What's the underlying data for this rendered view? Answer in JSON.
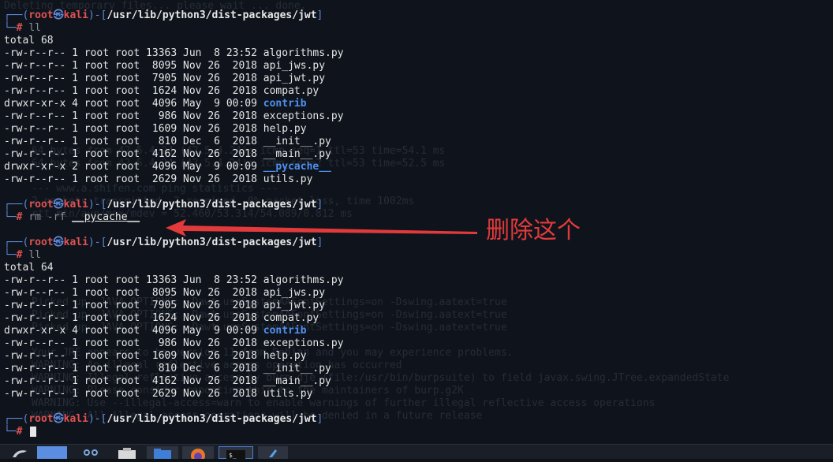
{
  "annotation": {
    "text": "删除这个"
  },
  "prompts": [
    {
      "user": "root",
      "host": "kali",
      "path": "/usr/lib/python3/dist-packages/jwt",
      "command": "ll"
    },
    {
      "user": "root",
      "host": "kali",
      "path": "/usr/lib/python3/dist-packages/jwt",
      "command_prefix": "rm -rf",
      "command_arg": "__pycache__"
    },
    {
      "user": "root",
      "host": "kali",
      "path": "/usr/lib/python3/dist-packages/jwt",
      "command": "ll"
    },
    {
      "user": "root",
      "host": "kali",
      "path": "/usr/lib/python3/dist-packages/jwt",
      "command": ""
    }
  ],
  "listing_before": {
    "total": "total 68",
    "rows": [
      {
        "perm": "-rw-r--r--",
        "links": "1",
        "owner": "root",
        "group": "root",
        "size": "13363",
        "month": "Jun",
        "day": " 8",
        "time": "23:52",
        "name": "algorithms.py",
        "is_dir": false
      },
      {
        "perm": "-rw-r--r--",
        "links": "1",
        "owner": "root",
        "group": "root",
        "size": " 8095",
        "month": "Nov",
        "day": "26",
        "time": " 2018",
        "name": "api_jws.py",
        "is_dir": false
      },
      {
        "perm": "-rw-r--r--",
        "links": "1",
        "owner": "root",
        "group": "root",
        "size": " 7905",
        "month": "Nov",
        "day": "26",
        "time": " 2018",
        "name": "api_jwt.py",
        "is_dir": false
      },
      {
        "perm": "-rw-r--r--",
        "links": "1",
        "owner": "root",
        "group": "root",
        "size": " 1624",
        "month": "Nov",
        "day": "26",
        "time": " 2018",
        "name": "compat.py",
        "is_dir": false
      },
      {
        "perm": "drwxr-xr-x",
        "links": "4",
        "owner": "root",
        "group": "root",
        "size": " 4096",
        "month": "May",
        "day": " 9",
        "time": "00:09",
        "name": "contrib",
        "is_dir": true
      },
      {
        "perm": "-rw-r--r--",
        "links": "1",
        "owner": "root",
        "group": "root",
        "size": "  986",
        "month": "Nov",
        "day": "26",
        "time": " 2018",
        "name": "exceptions.py",
        "is_dir": false
      },
      {
        "perm": "-rw-r--r--",
        "links": "1",
        "owner": "root",
        "group": "root",
        "size": " 1609",
        "month": "Nov",
        "day": "26",
        "time": " 2018",
        "name": "help.py",
        "is_dir": false
      },
      {
        "perm": "-rw-r--r--",
        "links": "1",
        "owner": "root",
        "group": "root",
        "size": "  810",
        "month": "Dec",
        "day": " 6",
        "time": " 2018",
        "name": "__init__.py",
        "is_dir": false
      },
      {
        "perm": "-rw-r--r--",
        "links": "1",
        "owner": "root",
        "group": "root",
        "size": " 4162",
        "month": "Nov",
        "day": "26",
        "time": " 2018",
        "name": "__main__.py",
        "is_dir": false
      },
      {
        "perm": "drwxr-xr-x",
        "links": "2",
        "owner": "root",
        "group": "root",
        "size": " 4096",
        "month": "May",
        "day": " 9",
        "time": "00:09",
        "name": "__pycache__",
        "is_dir": true
      },
      {
        "perm": "-rw-r--r--",
        "links": "1",
        "owner": "root",
        "group": "root",
        "size": " 2629",
        "month": "Nov",
        "day": "26",
        "time": " 2018",
        "name": "utils.py",
        "is_dir": false
      }
    ]
  },
  "listing_after": {
    "total": "total 64",
    "rows": [
      {
        "perm": "-rw-r--r--",
        "links": "1",
        "owner": "root",
        "group": "root",
        "size": "13363",
        "month": "Jun",
        "day": " 8",
        "time": "23:52",
        "name": "algorithms.py",
        "is_dir": false
      },
      {
        "perm": "-rw-r--r--",
        "links": "1",
        "owner": "root",
        "group": "root",
        "size": " 8095",
        "month": "Nov",
        "day": "26",
        "time": " 2018",
        "name": "api_jws.py",
        "is_dir": false
      },
      {
        "perm": "-rw-r--r--",
        "links": "1",
        "owner": "root",
        "group": "root",
        "size": " 7905",
        "month": "Nov",
        "day": "26",
        "time": " 2018",
        "name": "api_jwt.py",
        "is_dir": false
      },
      {
        "perm": "-rw-r--r--",
        "links": "1",
        "owner": "root",
        "group": "root",
        "size": " 1624",
        "month": "Nov",
        "day": "26",
        "time": " 2018",
        "name": "compat.py",
        "is_dir": false
      },
      {
        "perm": "drwxr-xr-x",
        "links": "4",
        "owner": "root",
        "group": "root",
        "size": " 4096",
        "month": "May",
        "day": " 9",
        "time": "00:09",
        "name": "contrib",
        "is_dir": true
      },
      {
        "perm": "-rw-r--r--",
        "links": "1",
        "owner": "root",
        "group": "root",
        "size": "  986",
        "month": "Nov",
        "day": "26",
        "time": " 2018",
        "name": "exceptions.py",
        "is_dir": false
      },
      {
        "perm": "-rw-r--r--",
        "links": "1",
        "owner": "root",
        "group": "root",
        "size": " 1609",
        "month": "Nov",
        "day": "26",
        "time": " 2018",
        "name": "help.py",
        "is_dir": false
      },
      {
        "perm": "-rw-r--r--",
        "links": "1",
        "owner": "root",
        "group": "root",
        "size": "  810",
        "month": "Dec",
        "day": " 6",
        "time": " 2018",
        "name": "__init__.py",
        "is_dir": false
      },
      {
        "perm": "-rw-r--r--",
        "links": "1",
        "owner": "root",
        "group": "root",
        "size": " 4162",
        "month": "Nov",
        "day": "26",
        "time": " 2018",
        "name": "__main__.py",
        "is_dir": false
      },
      {
        "perm": "-rw-r--r--",
        "links": "1",
        "owner": "root",
        "group": "root",
        "size": " 2629",
        "month": "Nov",
        "day": "26",
        "time": " 2018",
        "name": "utils.py",
        "is_dir": false
      }
    ]
  },
  "background_ghost_lines": [
    "Deleting temporary files... please wait ... done.",
    "64 bytes from 42.5.4.24 (42.5.4.24): icmp_seq=1 ttl=53 time=54.1 ms",
    "64 bytes from 42.5.4.24 (42.5.4.24): icmp_seq=2 ttl=53 time=52.5 ms",
    "--- www.a.shifen.com ping statistics ---",
    "2 packets transmitted, 2 received, 0% packet loss, time 1002ms",
    "rtt min/avg/max/mdev = 52.460/53.314/54.089/0.812 ms",
    "Picked up _JAVA_OPTIONS: -Dawt.useSystemAAFontSettings=on -Dswing.aatext=true",
    "Picked up _JAVA_OPTIONS: -Dawt.useSystemAAFontSettings=on -Dswing.aatext=true",
    "Picked up _JAVA_OPTIONS: -Dawt.useSystemAAFontSettings=on -Dswing.aatext=true",
    "Your JRE appears to be version 11 from Debian and you may experience problems.",
    "WARNING: An illegal reflective access operation has occurred",
    "WARNING: Illegal reflective access by burp.dje (file:/usr/bin/burpsuite) to field javax.swing.JTree.expandedState",
    "WARNING: Please consider reporting this to the maintainers of burp.g2K",
    "WARNING: Use --illegal-access=warn to enable warnings of further illegal reflective access operations",
    "WARNING: All illegal access operations will be denied in a future release"
  ],
  "colors": {
    "background": "#0f141c",
    "prompt_frame": "#5f87d7",
    "root_red": "#e05252",
    "directory_blue": "#4f8ff0",
    "annotation_red": "#e23a3a"
  },
  "taskbar": {
    "items": [
      "kali-dragon-icon",
      "workspace-icon",
      "settings-icon",
      "archive-icon",
      "folder-icon",
      "firefox-icon",
      "terminal-icon",
      "kali-tools-icon"
    ]
  }
}
